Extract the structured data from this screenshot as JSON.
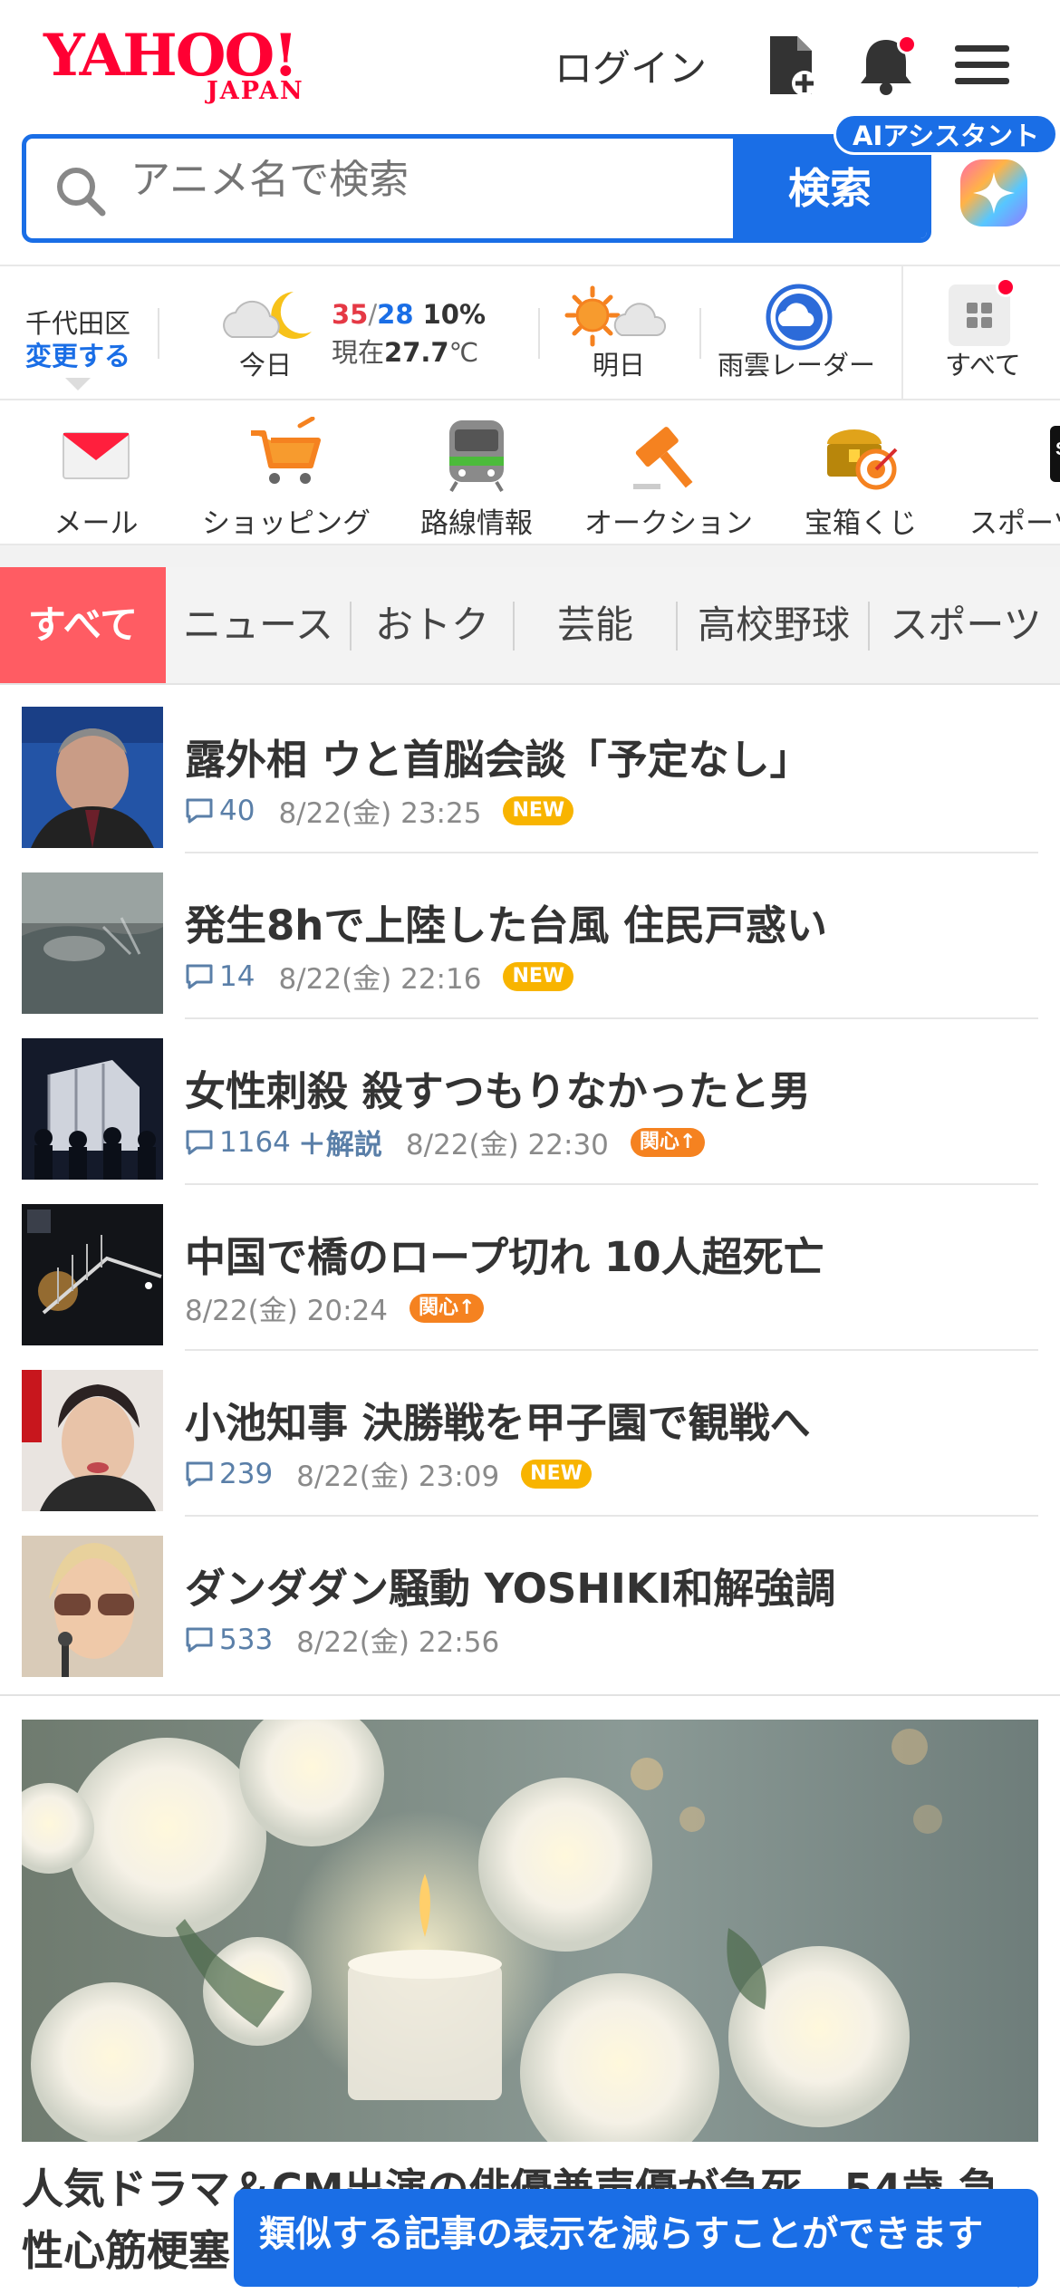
{
  "header": {
    "logo_main": "YAHOO!",
    "logo_sub": "JAPAN",
    "login_label": "ログイン"
  },
  "search": {
    "placeholder": "アニメ名で検索",
    "button_label": "検索",
    "ai_label": "AIアシスタント"
  },
  "weather": {
    "location": "千代田区",
    "change_label": "変更する",
    "today_label": "今日",
    "high": "35",
    "low": "28",
    "precip": "10%",
    "now_prefix": "現在",
    "now_temp": "27.7",
    "now_unit": "℃",
    "tomorrow_label": "明日",
    "radar_label": "雨雲レーダー",
    "all_label": "すべて"
  },
  "services": [
    {
      "label": "メール",
      "icon": "mail-icon"
    },
    {
      "label": "ショッピング",
      "icon": "cart-icon"
    },
    {
      "label": "路線情報",
      "icon": "train-icon"
    },
    {
      "label": "オークション",
      "icon": "gavel-icon"
    },
    {
      "label": "宝箱くじ",
      "icon": "treasure-icon"
    },
    {
      "label": "スポーツ",
      "icon": "sports-icon"
    }
  ],
  "tabs": [
    {
      "label": "すべて",
      "active": true
    },
    {
      "label": "ニュース"
    },
    {
      "label": "おトク"
    },
    {
      "label": "芸能"
    },
    {
      "label": "高校野球"
    },
    {
      "label": "スポーツ"
    }
  ],
  "news": [
    {
      "title": "露外相 ウと首脳会談「予定なし」",
      "comments": "40",
      "datetime": "8/22(金) 23:25",
      "tag": "NEW"
    },
    {
      "title": "発生8hで上陸した台風 住民戸惑い",
      "comments": "14",
      "datetime": "8/22(金) 22:16",
      "tag": "NEW"
    },
    {
      "title": "女性刺殺 殺すつもりなかったと男",
      "comments": "1164",
      "extra": "＋解説",
      "datetime": "8/22(金) 22:30",
      "tag": "関心↑"
    },
    {
      "title": "中国で橋のロープ切れ 10人超死亡",
      "comments": "",
      "datetime": "8/22(金) 20:24",
      "tag": "関心↑"
    },
    {
      "title": "小池知事 決勝戦を甲子園で観戦へ",
      "comments": "239",
      "datetime": "8/22(金) 23:09",
      "tag": "NEW"
    },
    {
      "title": "ダンダダン騒動 YOSHIKI和解強調",
      "comments": "533",
      "datetime": "8/22(金) 22:56",
      "tag": ""
    }
  ],
  "feature": {
    "title": "人気ドラマ＆CM出演の俳優兼声優が急死　54歳 急性心筋梗塞"
  },
  "toast": {
    "message": "類似する記事の表示を減らすことができます"
  },
  "colors": {
    "brand_red": "#ff0033",
    "accent_blue": "#1a6ee6",
    "tab_active": "#ff5c63",
    "tag_new": "#f8b400",
    "tag_hot": "#f58220"
  }
}
